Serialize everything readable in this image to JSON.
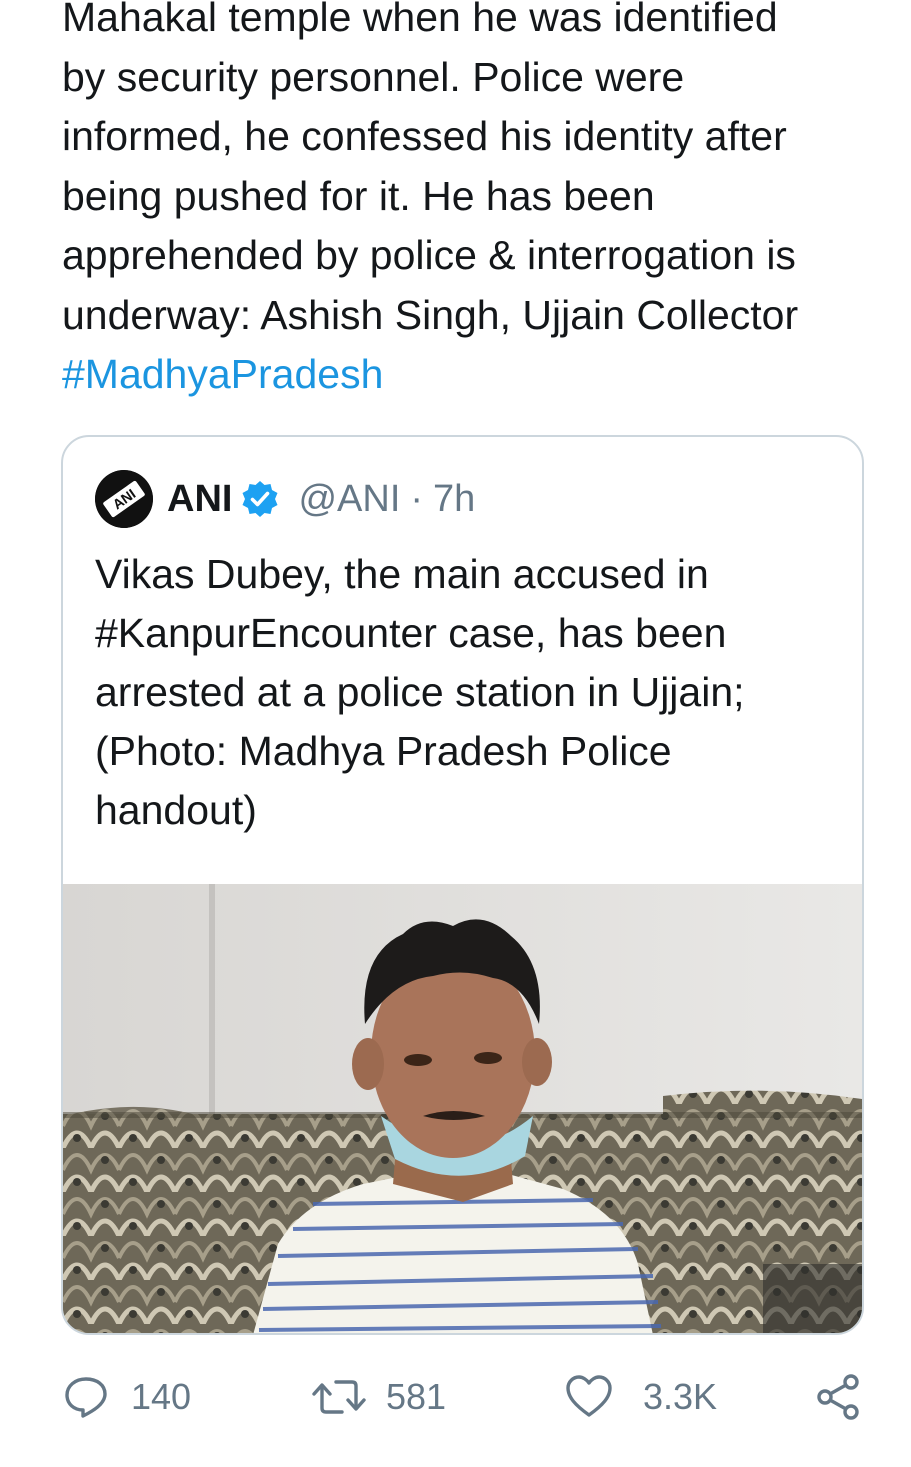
{
  "tweet": {
    "text_lines": [
      "Mahakal temple when he was identified",
      "by security personnel. Police were",
      "informed, he confessed his identity after",
      "being pushed for it. He has been",
      "apprehended by police & interrogation is",
      "underway: Ashish Singh, Ujjain Collector"
    ],
    "hashtag": "#MadhyaPradesh"
  },
  "quoted": {
    "avatar_text": "ANI",
    "name": "ANI",
    "handle": "@ANI",
    "separator": "·",
    "time": "7h",
    "text_lines": [
      "Vikas Dubey, the main accused in",
      "#KanpurEncounter case, has been",
      "arrested at a police station in Ujjain;",
      "(Photo: Madhya Pradesh Police",
      "handout)"
    ]
  },
  "actions": {
    "reply_count": "140",
    "retweet_count": "581",
    "like_count": "3.3K"
  },
  "colors": {
    "hashtag": "#1b95e0",
    "verified": "#1da1f2",
    "secondary_text": "#657786",
    "border": "#ccd6dd"
  },
  "icons": [
    "reply-icon",
    "retweet-icon",
    "like-icon",
    "share-icon",
    "verified-badge-icon"
  ]
}
